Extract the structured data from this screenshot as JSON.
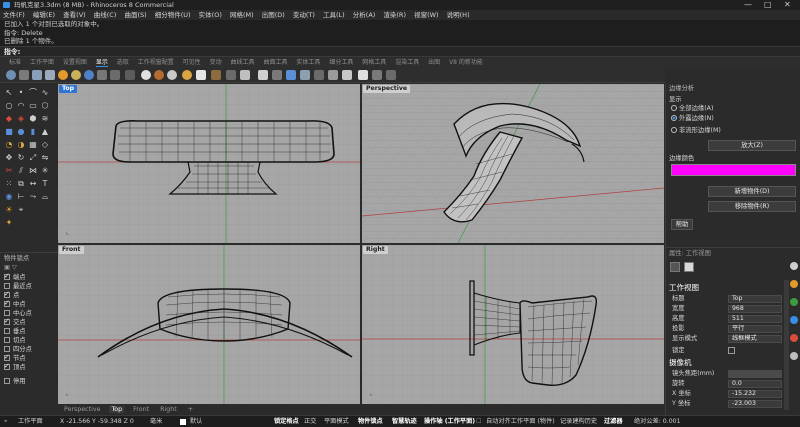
{
  "window": {
    "title": "玛帆克星3.3dm (8 MB) - Rhinoceros 8 Commercial",
    "controls": [
      "—",
      "□",
      "✕"
    ]
  },
  "menu": [
    "文件(F)",
    "编辑(E)",
    "查看(V)",
    "曲线(C)",
    "曲面(S)",
    "细分物件(U)",
    "实体(O)",
    "网格(M)",
    "出图(D)",
    "变动(T)",
    "工具(L)",
    "分析(A)",
    "渲染(R)",
    "视窗(W)",
    "说明(H)"
  ],
  "history": [
    "已加入 1 个对到已选取的对象中。",
    "指令: Delete",
    "已删除 1 个物件。"
  ],
  "command": {
    "prompt": "指令:",
    "value": ""
  },
  "toolbar_tabs": [
    "标准",
    "工作平面",
    "设置视图",
    "显示",
    "选取",
    "工作视窗配置",
    "可见性",
    "变动",
    "曲线工具",
    "曲面工具",
    "实体工具",
    "细分工具",
    "网格工具",
    "渲染工具",
    "出图",
    "V8 的新功能"
  ],
  "active_toolbar_tab": "显示",
  "viewports": {
    "top": "Top",
    "perspective": "Perspective",
    "front": "Front",
    "right": "Right"
  },
  "view_tabs": [
    "Perspective",
    "Top",
    "Front",
    "Right",
    "+"
  ],
  "active_view_tab": "Top",
  "layers": {
    "header": "物件锁点",
    "items": [
      {
        "label": "端点",
        "checked": true
      },
      {
        "label": "最近点",
        "checked": false
      },
      {
        "label": "点",
        "checked": true
      },
      {
        "label": "中点",
        "checked": true
      },
      {
        "label": "中心点",
        "checked": false
      },
      {
        "label": "交点",
        "checked": true
      },
      {
        "label": "垂点",
        "checked": false
      },
      {
        "label": "切点",
        "checked": false
      },
      {
        "label": "四分点",
        "checked": false
      },
      {
        "label": "节点",
        "checked": true
      },
      {
        "label": "顶点",
        "checked": true
      }
    ],
    "disable_label": "停用"
  },
  "edge_analysis": {
    "panel_title": "边缘分析",
    "display_label": "显示",
    "options": [
      "全部边缘(A)",
      "外露边缘(N)",
      "非流形边缘(M)"
    ],
    "selected": 1,
    "enlarge_button": "放大(Z)",
    "edge_color_label": "边缘颜色",
    "edge_color": "#ff00ff",
    "add_button": "新增物件(D)",
    "remove_button": "移除物件(R)",
    "help_button": "帮助"
  },
  "properties": {
    "tabs_title": "属性: 工作视图",
    "section": "工作视图",
    "rows": [
      {
        "label": "标题",
        "value": "Top"
      },
      {
        "label": "宽度",
        "value": "968"
      },
      {
        "label": "高度",
        "value": "511"
      },
      {
        "label": "投影",
        "value": "平行"
      },
      {
        "label": "显示模式",
        "value": "线框模式"
      },
      {
        "label": "锁定",
        "value": ""
      }
    ],
    "camera_section": "摄像机",
    "camera_rows": [
      {
        "label": "镜头焦距(mm)",
        "value": ""
      },
      {
        "label": "旋转",
        "value": "0.0"
      },
      {
        "label": "X 坐标",
        "value": "-15.232"
      },
      {
        "label": "Y 坐标",
        "value": "-23.003"
      }
    ]
  },
  "status": {
    "cplane": "工作平面",
    "coords": "X -21.566 Y -59.348 Z 0",
    "unit": "毫米",
    "layer": "默认",
    "toggles": [
      "锁定格点",
      "正交",
      "平面模式",
      "物件锁点",
      "智慧轨迹",
      "操作轴 (工作平面)",
      "自动对齐工作平面 (物件)",
      "记录建构历史",
      "过滤器"
    ],
    "tolerance": "绝对公差: 0.001"
  },
  "colors": {
    "viewport_bg": "#a6a6a6",
    "accent": "#2f74d0"
  }
}
